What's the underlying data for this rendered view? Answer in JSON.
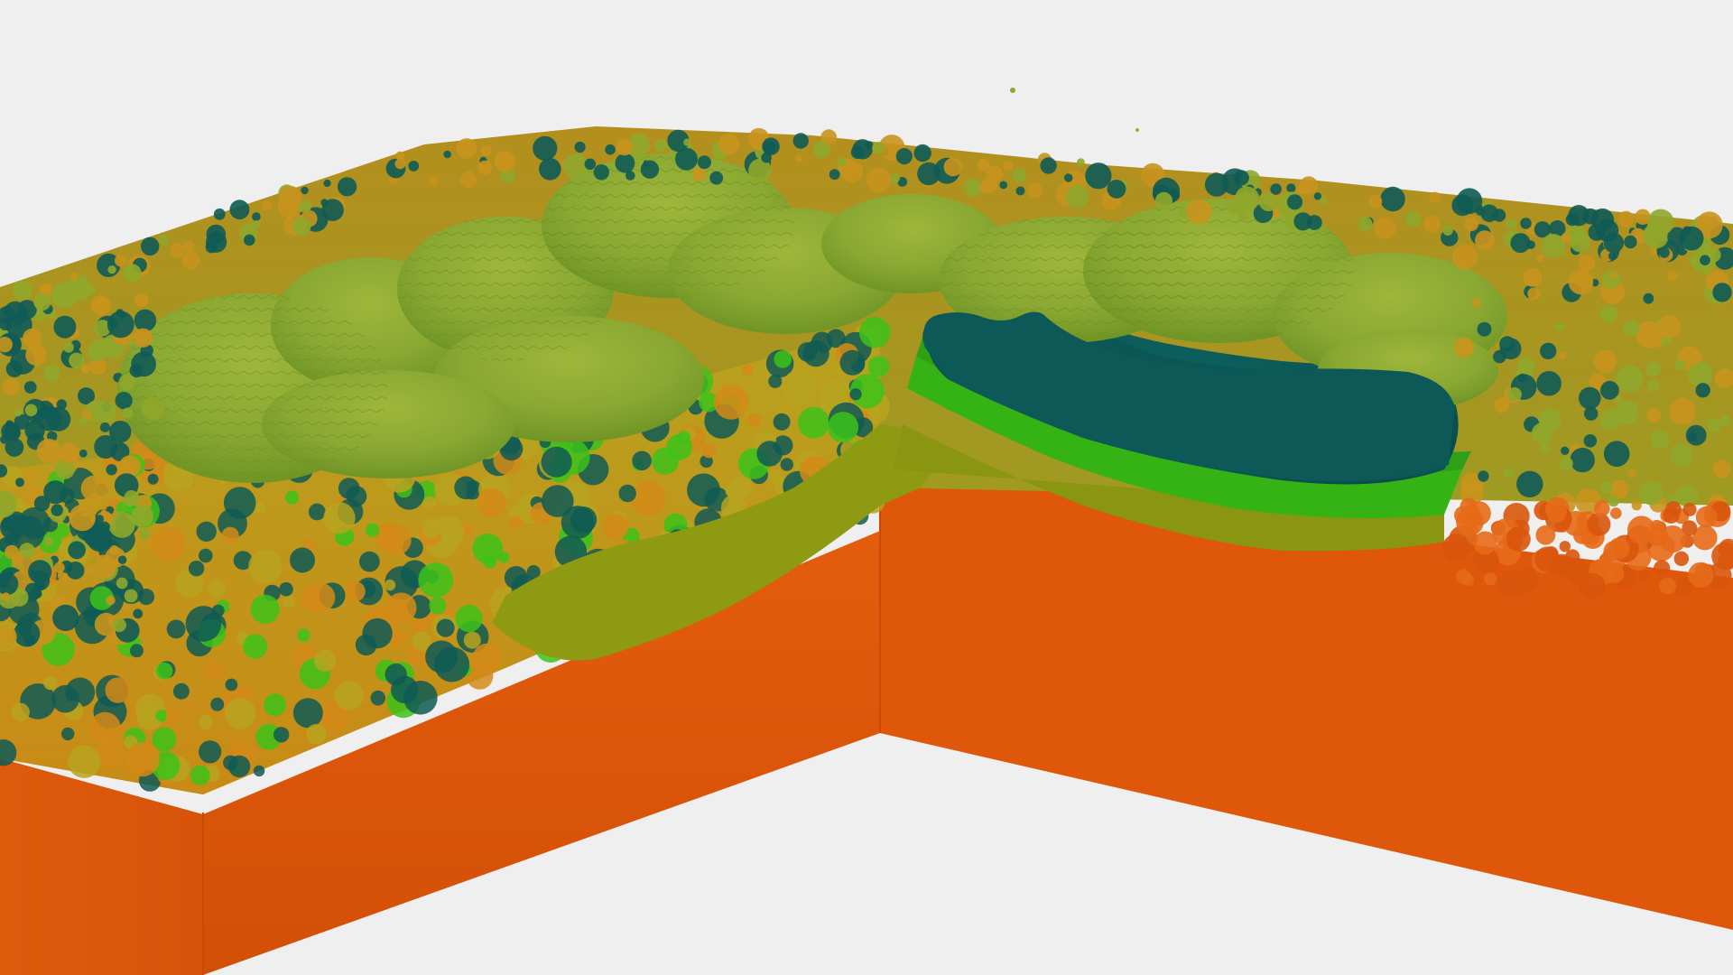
{
  "scene": {
    "colors": {
      "background": "#efefef",
      "base_orange": "#e05a0c",
      "base_orange_dark": "#d25208",
      "base_orange_side": "#d84f07",
      "olive_layer": "#8a9a12",
      "green_layer": "#2fa514",
      "bright_green_layer": "#3cc21a",
      "dark_teal_lake": "#0c5a58",
      "teal_dark": "#0f5b55",
      "yellow_green_top": "#9db42a",
      "mottled_orange": "#c9901a",
      "hill_light": "#a6b62a",
      "hill_mid": "#7fa32a"
    }
  }
}
